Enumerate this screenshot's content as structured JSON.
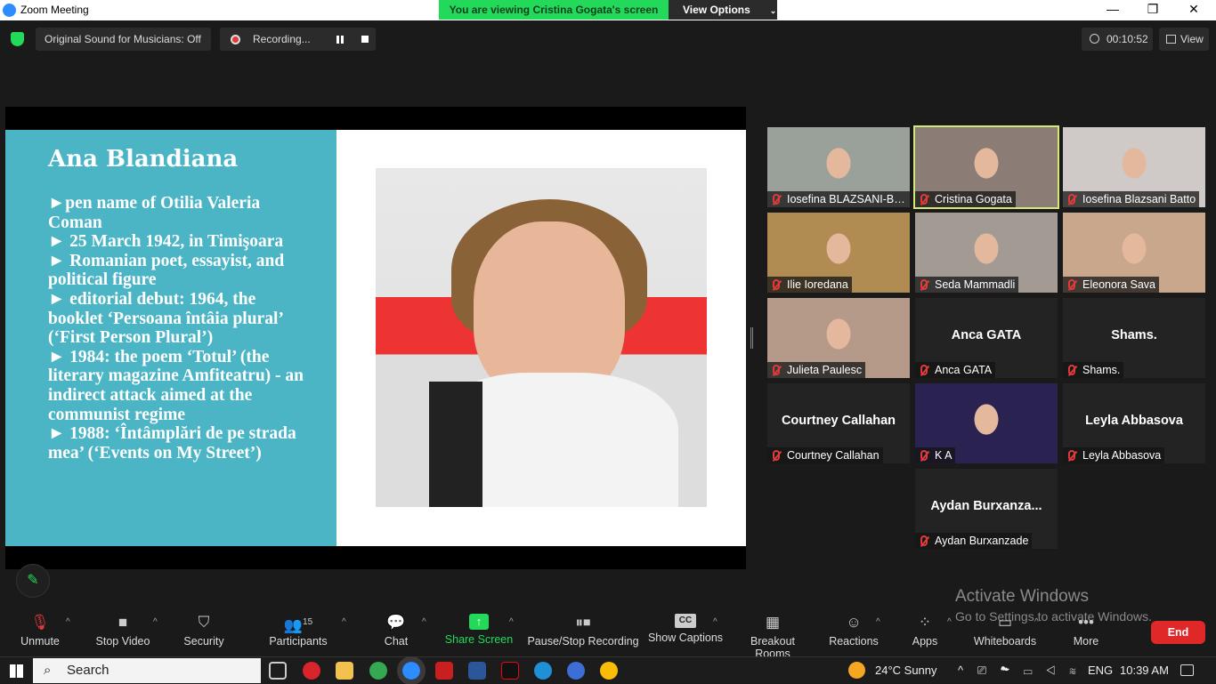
{
  "window": {
    "title": "Zoom Meeting",
    "minimize": "—",
    "maximize": "❐",
    "close": "✕"
  },
  "banner": {
    "message": "You are viewing Cristina Gogata's screen",
    "view_options": "View Options",
    "chevron": "⌄"
  },
  "topbar": {
    "original_sound": "Original Sound for Musicians: Off",
    "recording_label": "Recording...",
    "timer": "00:10:52",
    "view_label": "View"
  },
  "slide": {
    "title": "Ana Blandiana",
    "bullets": [
      "►pen name of Otilia Valeria Coman",
      "► 25 March 1942, in Timişoara",
      "► Romanian poet, essayist, and political figure",
      "► editorial debut: 1964, the booklet  ‘Persoana întâia plural’ (‘First Person Plural’)",
      "► 1984: the poem ‘Totul’ (the literary magazine Amfiteatru) - an indirect attack aimed at the communist regime",
      "► 1988: ‘Întâmplări de pe strada mea’ (‘Events on My Street’)"
    ]
  },
  "participants": [
    {
      "name": "Iosefina BLAZSANI-BA...",
      "center": "",
      "video": "#9aa19a"
    },
    {
      "name": "Cristina Gogata",
      "center": "",
      "video": "#8b7d75",
      "speaking": true
    },
    {
      "name": "Iosefina Blazsani Batto",
      "center": "",
      "video": "#cfcac7"
    },
    {
      "name": "Ilie Ioredana",
      "center": "",
      "video": "#b08b52"
    },
    {
      "name": "Seda Mammadli",
      "center": "",
      "video": "#a39a94"
    },
    {
      "name": "Eleonora Sava",
      "center": "",
      "video": "#c9a78d"
    },
    {
      "name": "Julieta Paulesc",
      "center": "",
      "video": "#b59a8a"
    },
    {
      "name": "Anca GATA",
      "center": "Anca GATA",
      "video": ""
    },
    {
      "name": "Shams.",
      "center": "Shams.",
      "video": ""
    },
    {
      "name": "Courtney Callahan",
      "center": "Courtney Callahan",
      "video": ""
    },
    {
      "name": "K A",
      "center": "",
      "video": "#2a2250"
    },
    {
      "name": "Leyla Abbasova",
      "center": "Leyla Abbasova",
      "video": ""
    },
    {
      "name": "Aydan Burxanzade",
      "center": "Aydan  Burxanza...",
      "video": ""
    }
  ],
  "toolbar": {
    "unmute": "Unmute",
    "stop_video": "Stop Video",
    "security": "Security",
    "participants": "Participants",
    "participants_count": "15",
    "chat": "Chat",
    "share_screen": "Share Screen",
    "pause_stop_recording": "Pause/Stop Recording",
    "show_captions": "Show Captions",
    "captions_badge": "CC",
    "breakout_rooms": "Breakout Rooms",
    "reactions": "Reactions",
    "apps": "Apps",
    "whiteboards": "Whiteboards",
    "more": "More",
    "end": "End"
  },
  "watermark": {
    "line1": "Activate Windows",
    "line2": "Go to Settings to activate Windows."
  },
  "taskbar": {
    "search": "Search",
    "weather": "24°C  Sunny",
    "language": "ENG",
    "time": "10:39 AM"
  },
  "colors": {
    "accent_green": "#23d959",
    "end_red": "#e02828",
    "slide_blue": "#4bb5c6",
    "speaker_outline": "#d4e87a"
  }
}
